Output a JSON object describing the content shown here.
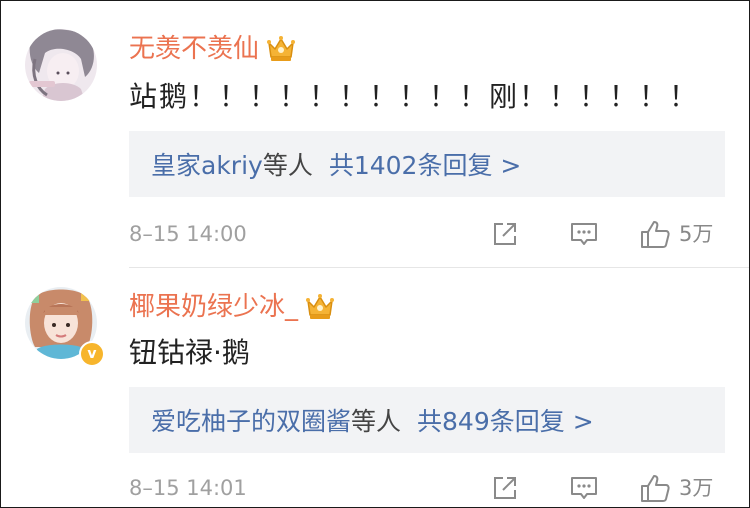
{
  "comments": [
    {
      "username": "无羡不羡仙",
      "member_badge": "crown-icon",
      "content": "站鹅！！！！！！！！！！刚！！！！！！",
      "replies": {
        "users": "皇家akriy",
        "users_suffix": "等人",
        "count_text": "共1402条回复 >"
      },
      "timestamp": "8–15 14:00",
      "likes": "5万"
    },
    {
      "username": "椰果奶绿少冰_",
      "member_badge": "crown-icon",
      "verified_badge": "v-badge-icon",
      "content": "钮钴禄·鹅",
      "replies": {
        "users": "爱吃柚子的双圈酱",
        "users_suffix": "等人",
        "count_text": "共849条回复 >"
      },
      "timestamp": "8–15 14:01",
      "likes": "3万"
    }
  ],
  "colors": {
    "username": "#eb7350",
    "link": "#4a6ea9",
    "replies_bg": "#f2f3f5",
    "meta": "#a0a0a0",
    "crown": "#f5b335"
  },
  "verified_mark": "v"
}
